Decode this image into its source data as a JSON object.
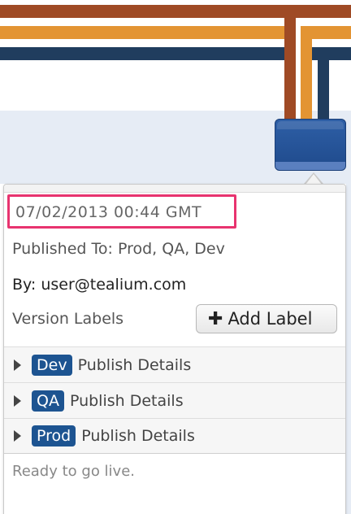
{
  "panel": {
    "timestamp": "07/02/2013 00:44 GMT",
    "published_to": "Published To: Prod, QA, Dev",
    "by": "By: user@tealium.com",
    "version_labels": "Version Labels",
    "add_label_button": "Add Label",
    "add_label_icon": "plus-icon",
    "publish_rows": [
      {
        "env": "Dev",
        "text": "Publish Details"
      },
      {
        "env": "QA",
        "text": "Publish Details"
      },
      {
        "env": "Prod",
        "text": "Publish Details"
      }
    ],
    "note": "Ready to go live."
  },
  "colors": {
    "stripe_rust": "#9f4a25",
    "stripe_orange": "#e39433",
    "stripe_navy": "#203d5e",
    "node_blue": "#2e5fa6",
    "highlight_pink": "#e8336f",
    "badge_blue": "#1d5491"
  }
}
